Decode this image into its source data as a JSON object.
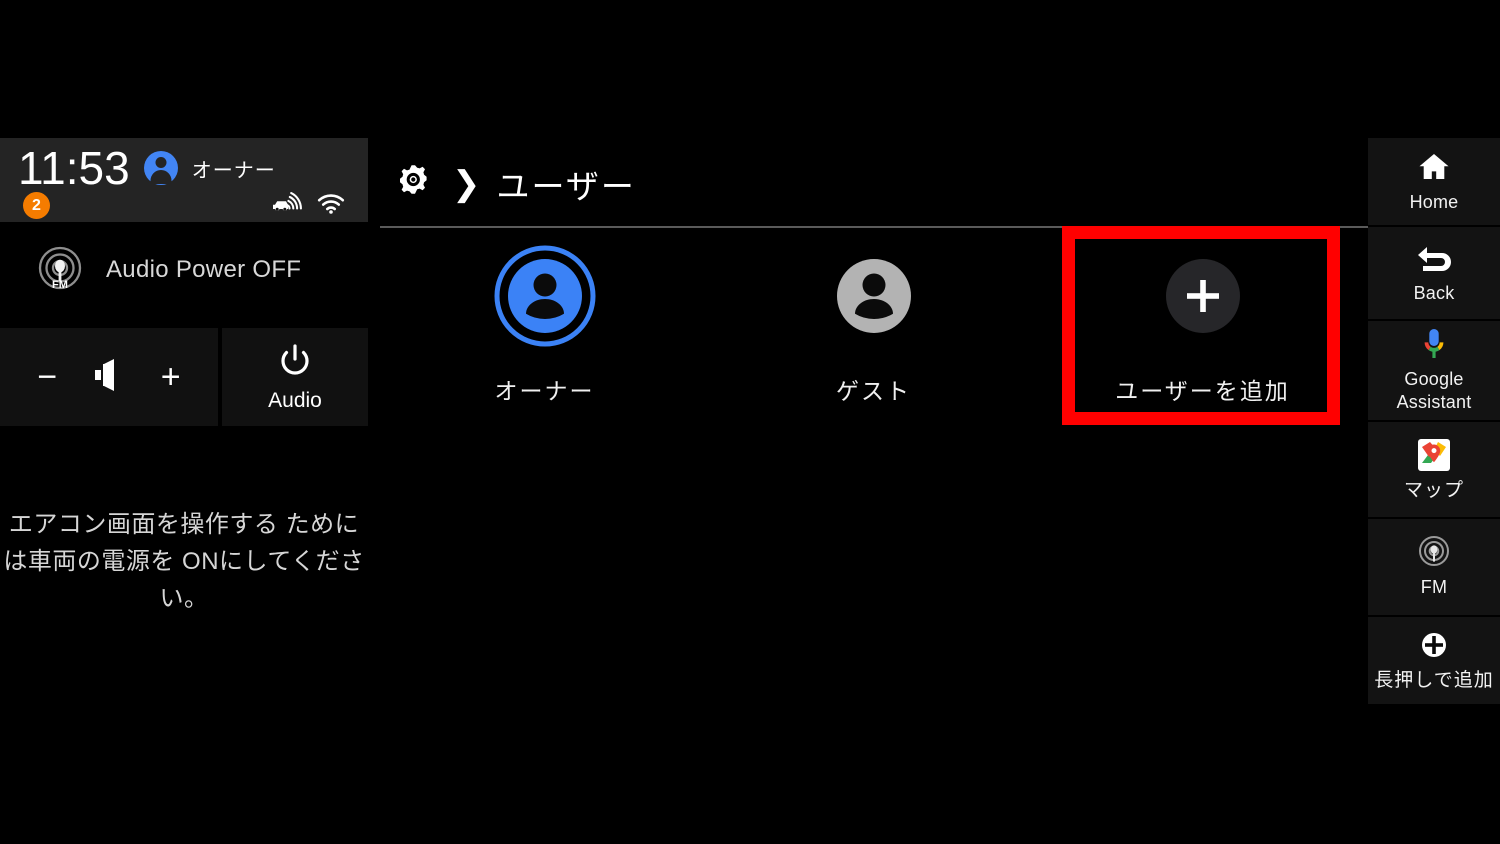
{
  "status_bar": {
    "time": "11:53",
    "user_name": "オーナー",
    "notification_count": "2",
    "icons": [
      "car-signal-icon",
      "wifi-icon"
    ]
  },
  "audio": {
    "source_icon": "fm-broadcast-icon",
    "source_label": "Audio Power OFF",
    "volume_down": "−",
    "volume_icon": "speaker-icon",
    "volume_up": "+",
    "power_icon": "power-icon",
    "power_label": "Audio"
  },
  "hvac": {
    "message": "エアコン画面を操作する\nためには車両の電源を\nONにしてください。"
  },
  "header": {
    "settings_icon": "gear-icon",
    "separator": "❯",
    "title": "ユーザー"
  },
  "users": [
    {
      "label": "オーナー",
      "icon": "person-avatar-icon",
      "selected": true,
      "color": "#4285f4"
    },
    {
      "label": "ゲスト",
      "icon": "person-avatar-icon",
      "selected": false,
      "color": "#b0b0b0"
    },
    {
      "label": "ユーザーを追加",
      "icon": "plus-icon",
      "selected": false,
      "color": "#262629"
    }
  ],
  "highlight": {
    "color": "#ff0000",
    "target": "ユーザーを追加"
  },
  "sidebar": {
    "items": [
      {
        "label": "Home",
        "icon": "home-icon"
      },
      {
        "label": "Back",
        "icon": "back-arrow-icon"
      },
      {
        "label": "Google\nAssistant",
        "icon": "google-assistant-mic-icon"
      },
      {
        "label": "マップ",
        "icon": "google-maps-icon"
      },
      {
        "label": "FM",
        "icon": "fm-broadcast-icon"
      },
      {
        "label": "長押しで追加",
        "icon": "plus-circle-icon"
      }
    ]
  }
}
